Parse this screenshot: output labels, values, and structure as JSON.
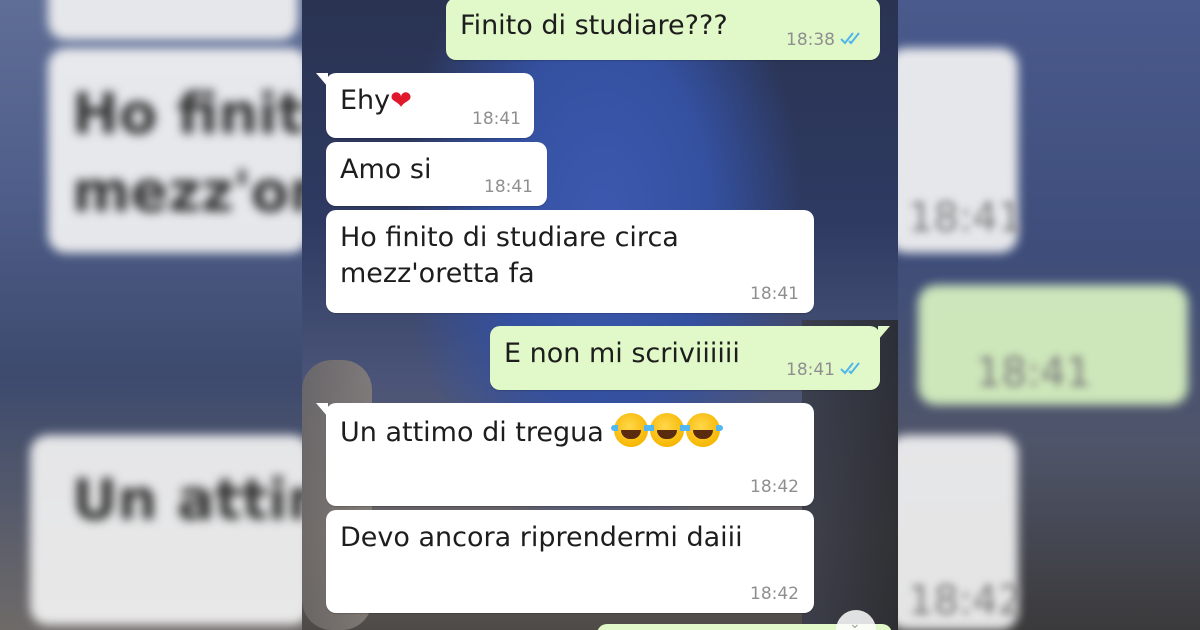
{
  "messages": [
    {
      "dir": "out",
      "text": "Finito di studiare???",
      "time": "18:38",
      "status": "read"
    },
    {
      "dir": "in",
      "text": "Ehy",
      "emoji": "❤",
      "time": "18:41"
    },
    {
      "dir": "in",
      "text": "Amo si",
      "time": "18:41"
    },
    {
      "dir": "in",
      "line1": "Ho finito di studiare circa",
      "line2": "mezz'oretta fa",
      "time": "18:41"
    },
    {
      "dir": "out",
      "text": "E non mi scriviiiiii",
      "time": "18:41",
      "status": "read"
    },
    {
      "dir": "in",
      "text": "Un attimo di tregua",
      "emoji_name": "face-with-tears-of-joy",
      "time": "18:42"
    },
    {
      "dir": "in",
      "text": "Devo ancora riprendermi daiii",
      "time": "18:42"
    }
  ],
  "blurred": {
    "left_line1": "Ho finito",
    "left_line2": "mezz'ore",
    "left_line3": "Un attim",
    "right_time1": "18:41",
    "right_time2": "18:41",
    "right_time3": "18:42"
  },
  "colors": {
    "incoming_bubble": "#ffffff",
    "outgoing_bubble": "#e1f8c9",
    "read_tick": "#4fb6ec",
    "heart": "#e0182d"
  },
  "icons": [
    "double-check-icon",
    "heart-emoji",
    "tears-of-joy-emoji",
    "scroll-down-icon"
  ]
}
